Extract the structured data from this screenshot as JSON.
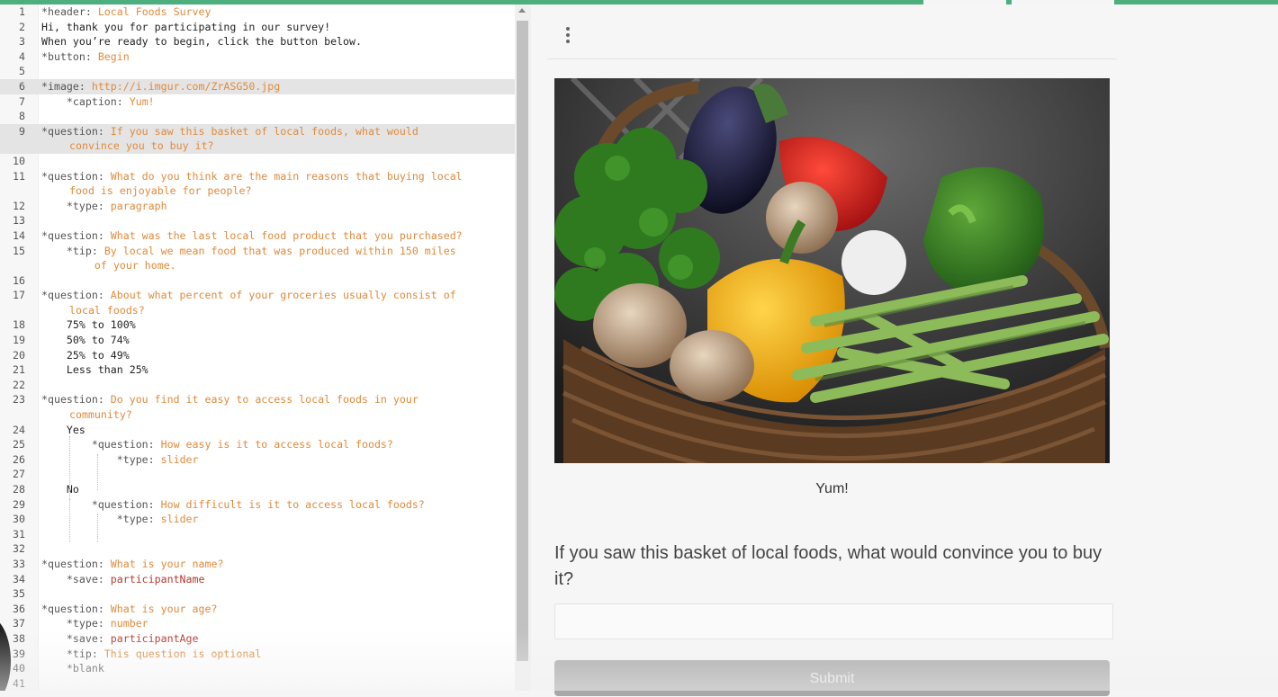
{
  "editor": {
    "lines": [
      {
        "n": "1",
        "parts": [
          {
            "c": "k",
            "t": "*header: "
          },
          {
            "c": "v",
            "t": "Local Foods Survey"
          }
        ]
      },
      {
        "n": "2",
        "parts": [
          {
            "c": "p",
            "t": "Hi, thank you for participating in our survey!"
          }
        ]
      },
      {
        "n": "3",
        "parts": [
          {
            "c": "p",
            "t": "When you’re ready to begin, click the button below."
          }
        ]
      },
      {
        "n": "4",
        "parts": [
          {
            "c": "k",
            "t": "*button: "
          },
          {
            "c": "v",
            "t": "Begin"
          }
        ]
      },
      {
        "n": "5",
        "parts": []
      },
      {
        "n": "6",
        "hl": true,
        "parts": [
          {
            "c": "k",
            "t": "*image: "
          },
          {
            "c": "v",
            "t": "http://i.imgur.com/ZrASG50.jpg"
          }
        ]
      },
      {
        "n": "7",
        "parts": [
          {
            "c": "k",
            "t": "    *caption: "
          },
          {
            "c": "v",
            "t": "Yum!"
          }
        ]
      },
      {
        "n": "8",
        "parts": []
      },
      {
        "n": "9",
        "hl": true,
        "wrap": true,
        "parts": [
          {
            "c": "k",
            "t": "*question: "
          },
          {
            "c": "v",
            "t": "If you saw this basket of local foods, what would"
          }
        ],
        "cont": [
          {
            "c": "v",
            "t": "convince you to buy it?"
          }
        ]
      },
      {
        "n": "10",
        "parts": []
      },
      {
        "n": "11",
        "wrap": true,
        "parts": [
          {
            "c": "k",
            "t": "*question: "
          },
          {
            "c": "v",
            "t": "What do you think are the main reasons that buying local"
          }
        ],
        "cont": [
          {
            "c": "v",
            "t": "food is enjoyable for people?"
          }
        ]
      },
      {
        "n": "12",
        "parts": [
          {
            "c": "k",
            "t": "    *type: "
          },
          {
            "c": "v",
            "t": "paragraph"
          }
        ]
      },
      {
        "n": "13",
        "parts": []
      },
      {
        "n": "14",
        "parts": [
          {
            "c": "k",
            "t": "*question: "
          },
          {
            "c": "v",
            "t": "What was the last local food product that you purchased?"
          }
        ]
      },
      {
        "n": "15",
        "wrap": true,
        "parts": [
          {
            "c": "k",
            "t": "    *tip: "
          },
          {
            "c": "v",
            "t": "By local we mean food that was produced within 150 miles"
          }
        ],
        "cont": [
          {
            "c": "v",
            "t": "    of your home."
          }
        ]
      },
      {
        "n": "16",
        "parts": []
      },
      {
        "n": "17",
        "wrap": true,
        "parts": [
          {
            "c": "k",
            "t": "*question: "
          },
          {
            "c": "v",
            "t": "About what percent of your groceries usually consist of"
          }
        ],
        "cont": [
          {
            "c": "v",
            "t": "local foods?"
          }
        ]
      },
      {
        "n": "18",
        "parts": [
          {
            "c": "p",
            "t": "    75% to 100%"
          }
        ]
      },
      {
        "n": "19",
        "parts": [
          {
            "c": "p",
            "t": "    50% to 74%"
          }
        ]
      },
      {
        "n": "20",
        "parts": [
          {
            "c": "p",
            "t": "    25% to 49%"
          }
        ]
      },
      {
        "n": "21",
        "parts": [
          {
            "c": "p",
            "t": "    Less than 25%"
          }
        ]
      },
      {
        "n": "22",
        "parts": []
      },
      {
        "n": "23",
        "wrap": true,
        "parts": [
          {
            "c": "k",
            "t": "*question: "
          },
          {
            "c": "v",
            "t": "Do you find it easy to access local foods in your"
          }
        ],
        "cont": [
          {
            "c": "v",
            "t": "community?"
          }
        ]
      },
      {
        "n": "24",
        "parts": [
          {
            "c": "p",
            "t": "    Yes"
          }
        ]
      },
      {
        "n": "25",
        "parts": [
          {
            "c": "k",
            "t": "        *question: "
          },
          {
            "c": "v",
            "t": "How easy is it to access local foods?"
          }
        ]
      },
      {
        "n": "26",
        "parts": [
          {
            "c": "k",
            "t": "            *type: "
          },
          {
            "c": "v",
            "t": "slider"
          }
        ]
      },
      {
        "n": "27",
        "parts": []
      },
      {
        "n": "28",
        "parts": [
          {
            "c": "p",
            "t": "    No"
          }
        ]
      },
      {
        "n": "29",
        "parts": [
          {
            "c": "k",
            "t": "        *question: "
          },
          {
            "c": "v",
            "t": "How difficult is it to access local foods?"
          }
        ]
      },
      {
        "n": "30",
        "parts": [
          {
            "c": "k",
            "t": "            *type: "
          },
          {
            "c": "v",
            "t": "slider"
          }
        ]
      },
      {
        "n": "31",
        "parts": []
      },
      {
        "n": "32",
        "parts": []
      },
      {
        "n": "33",
        "parts": [
          {
            "c": "k",
            "t": "*question: "
          },
          {
            "c": "v",
            "t": "What is your name?"
          }
        ]
      },
      {
        "n": "34",
        "parts": [
          {
            "c": "k",
            "t": "    *save: "
          },
          {
            "c": "d",
            "t": "participantName"
          }
        ]
      },
      {
        "n": "35",
        "parts": []
      },
      {
        "n": "36",
        "parts": [
          {
            "c": "k",
            "t": "*question: "
          },
          {
            "c": "v",
            "t": "What is your age?"
          }
        ]
      },
      {
        "n": "37",
        "parts": [
          {
            "c": "k",
            "t": "    *type: "
          },
          {
            "c": "v",
            "t": "number"
          }
        ]
      },
      {
        "n": "38",
        "parts": [
          {
            "c": "k",
            "t": "    *save: "
          },
          {
            "c": "d",
            "t": "participantAge"
          }
        ]
      },
      {
        "n": "39",
        "parts": [
          {
            "c": "k",
            "t": "    *tip: "
          },
          {
            "c": "v",
            "t": "This question is optional"
          }
        ]
      },
      {
        "n": "40",
        "parts": [
          {
            "c": "k",
            "t": "    *blank"
          }
        ]
      },
      {
        "n": "41",
        "parts": []
      }
    ]
  },
  "preview": {
    "menu_icon": "vertical-dots-icon",
    "image_subject": "basket-of-vegetables",
    "caption": "Yum!",
    "question": "If you saw this basket of local foods, what would convince you to buy it?",
    "answer_value": "",
    "submit_label": "Submit"
  },
  "colors": {
    "accent_bar": "#4caf7d",
    "code_value": "#e08a3c",
    "code_save_value": "#b03a30",
    "submit_bg": "#a8a8a8"
  }
}
